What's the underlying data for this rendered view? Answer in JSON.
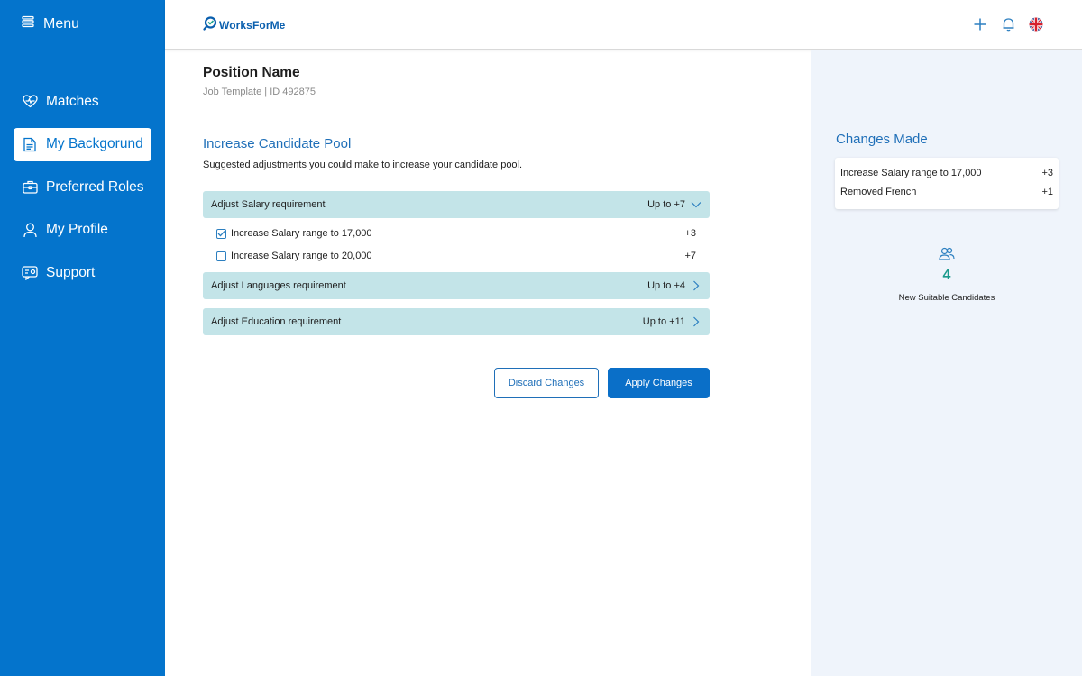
{
  "sidebar": {
    "menu_label": "Menu",
    "items": [
      {
        "label": "Matches",
        "icon": "heart-icon"
      },
      {
        "label": "My Backgorund",
        "icon": "document-icon",
        "active": true
      },
      {
        "label": "Preferred Roles",
        "icon": "briefcase-icon"
      },
      {
        "label": "My Profile",
        "icon": "user-icon"
      },
      {
        "label": "Support",
        "icon": "support-icon"
      }
    ]
  },
  "header": {
    "brand": "WorksForMe",
    "icons": [
      "plus-icon",
      "bell-icon",
      "uk-flag-icon"
    ]
  },
  "main": {
    "title": "Position Name",
    "subtitle": "Job Template |  ID 492875",
    "section_title": "Increase Candidate Pool",
    "section_desc": "Suggested adjustments you could make to increase your candidate pool.",
    "accordions": [
      {
        "label": "Adjust Salary requirement",
        "value": "Up to +7",
        "expanded": true,
        "options": [
          {
            "label": "Increase Salary range to 17,000",
            "value": "+3",
            "checked": true
          },
          {
            "label": "Increase Salary range to 20,000",
            "value": "+7",
            "checked": false
          }
        ]
      },
      {
        "label": "Adjust Languages requirement",
        "value": "Up to +4",
        "expanded": false
      },
      {
        "label": "Adjust Education requirement",
        "value": "Up to +11",
        "expanded": false
      }
    ],
    "buttons": {
      "discard": "Discard Changes",
      "apply": "Apply Changes"
    }
  },
  "right_panel": {
    "title": "Changes Made",
    "changes": [
      {
        "label": "Increase Salary range to 17,000",
        "value": "+3"
      },
      {
        "label": "Removed French",
        "value": "+1"
      }
    ],
    "candidates_count": "4",
    "candidates_label": "New Suitable Candidates"
  },
  "colors": {
    "sidebar_bg": "#0474cc",
    "accent": "#1f6fb8",
    "accordion_bg": "#c3e4e8",
    "right_panel_bg": "#eff4fb",
    "count_color": "#1a9a8c"
  }
}
